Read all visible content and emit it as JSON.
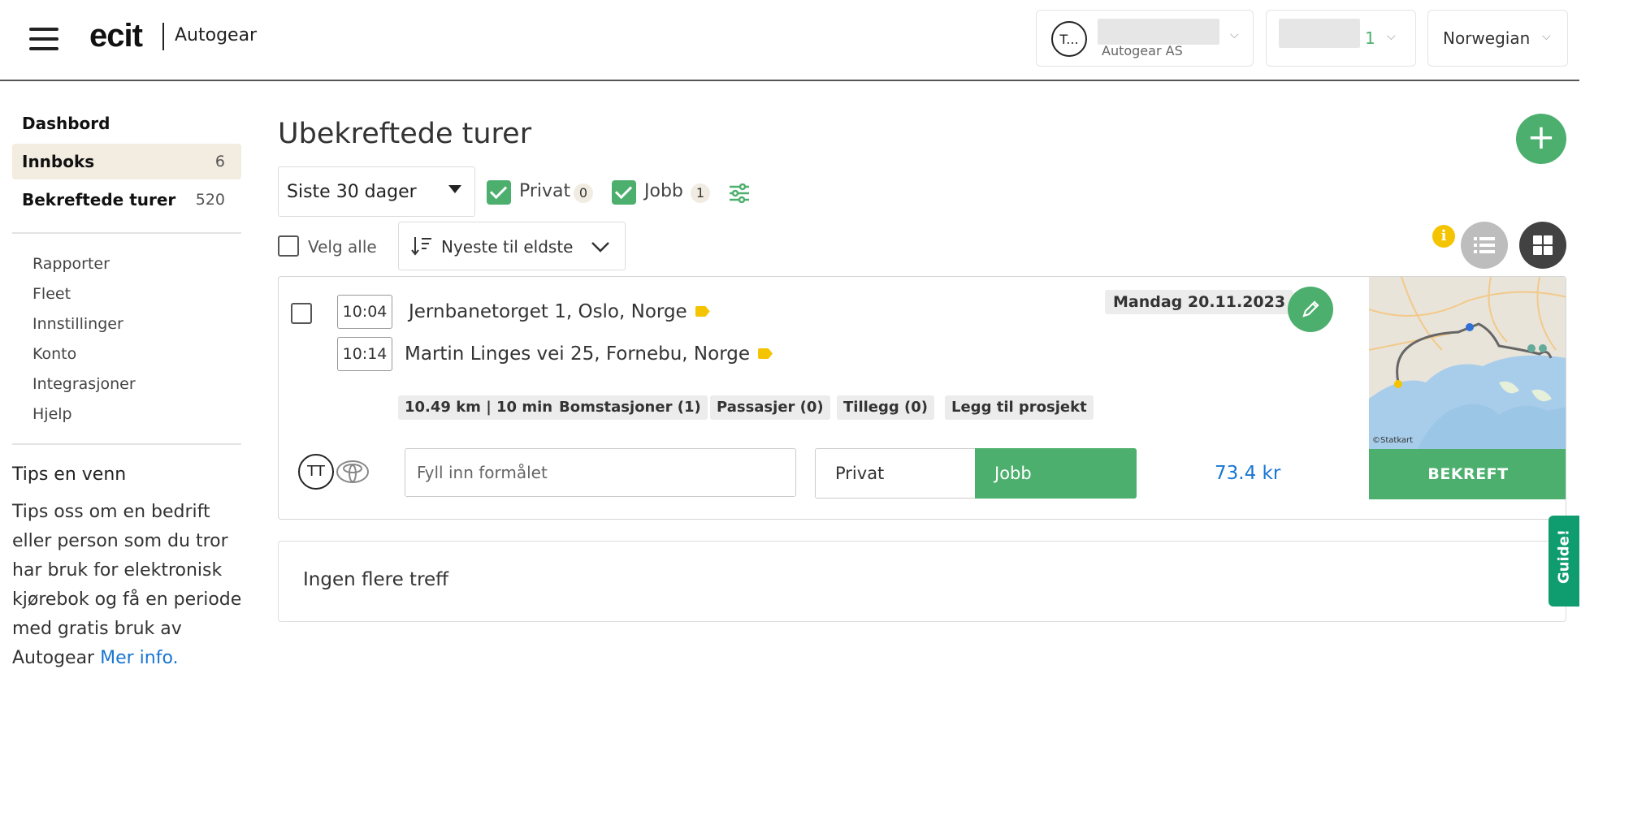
{
  "app": {
    "logo_text": "ecit",
    "product": "Autogear"
  },
  "header": {
    "user_initials": "T...",
    "company": "Autogear AS",
    "count": "1",
    "language": "Norwegian"
  },
  "sidebar": {
    "main_items": [
      {
        "label": "Dashbord",
        "count": ""
      },
      {
        "label": "Innboks",
        "count": "6"
      },
      {
        "label": "Bekreftede turer",
        "count": "520"
      }
    ],
    "links": [
      "Rapporter",
      "Fleet",
      "Innstillinger",
      "Konto",
      "Integrasjoner",
      "Hjelp"
    ],
    "tips": {
      "title": "Tips en venn",
      "text": "Tips oss om en bedrift eller person som du tror har bruk for elektronisk kjørebok og få en periode med gratis bruk av Autogear",
      "link": "Mer info."
    }
  },
  "main": {
    "title": "Ubekreftede turer",
    "period": "Siste 30 dager",
    "filters": [
      {
        "label": "Privat",
        "count": "0",
        "checked": true
      },
      {
        "label": "Jobb",
        "count": "1",
        "checked": true
      }
    ],
    "select_all": "Velg alle",
    "sort": "Nyeste til eldste"
  },
  "trip": {
    "start_time": "10:04",
    "start_address": "Jernbanetorget 1, Oslo, Norge",
    "end_time": "10:14",
    "end_address": "Martin Linges vei 25, Fornebu, Norge",
    "date": "Mandag 20.11.2023",
    "chips": [
      "10.49 km | 10 min",
      "Bomstasjoner (1)",
      "Passasjer (0)",
      "Tillegg (0)",
      "Legg til prosjekt"
    ],
    "driver_initials": "TT",
    "purpose_placeholder": "Fyll inn formålet",
    "type_private": "Privat",
    "type_job": "Jobb",
    "price": "73.4 kr",
    "confirm": "BEKREFT",
    "map_credit": "©Statkart"
  },
  "no_results": "Ingen flere treff",
  "guide": "Guide!",
  "colors": {
    "accent_green": "#4caf6d",
    "link_blue": "#1976d2",
    "active_bg": "#f3ece1",
    "guide_green": "#0f9d6f",
    "info_yellow": "#f5c400"
  }
}
